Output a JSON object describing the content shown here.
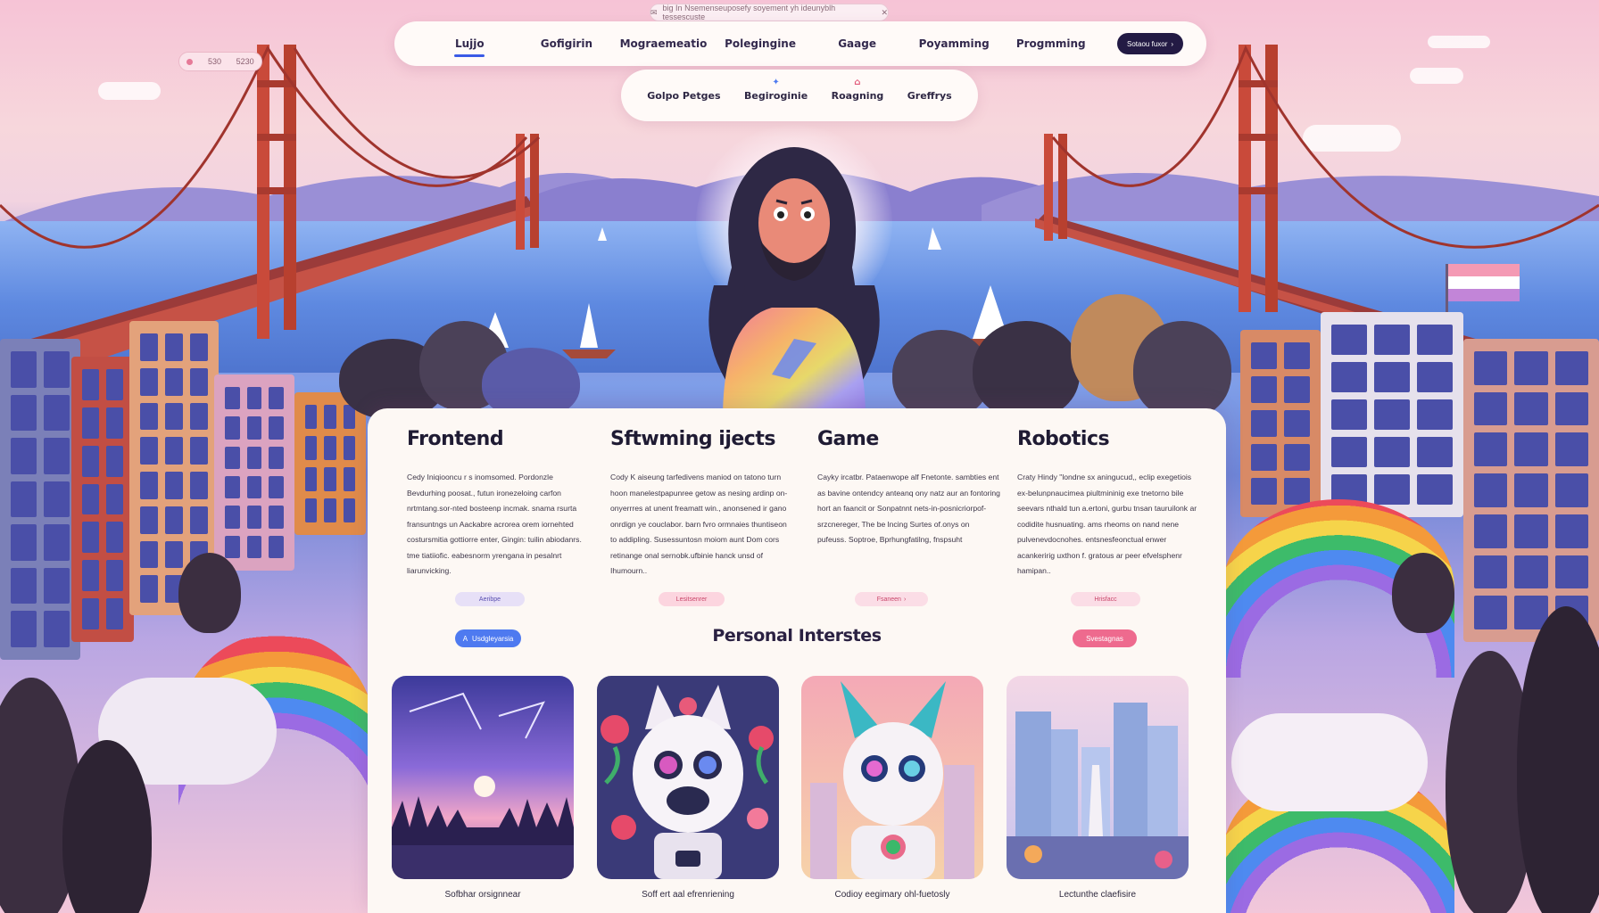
{
  "notification": {
    "text": "big In Nsemenseuposefy soyement yh ideunyblh tessescuste",
    "close_icon": "close-icon"
  },
  "mini_pill": {
    "left": "530",
    "right": "5230"
  },
  "nav": {
    "items": [
      "Lujjo",
      "Gofigirin",
      "Mograemeatio",
      "Polegingine",
      "Gaage",
      "Poyamming",
      "Progmming"
    ],
    "active_index": 0,
    "cta_label": "Sotaou fuxor"
  },
  "subnav": {
    "items": [
      "Golpo Petges",
      "Begiroginie",
      "Roagning",
      "Greffrys"
    ]
  },
  "columns": [
    {
      "title": "Frontend",
      "text": "Cedy Iniqiooncu r s inomsomed. Pordonzle Bevdurhing poosat., futun ironezeloing carfon nrtmtang.sor-nted bosteenp incmak. snama rsurta fransuntngs un Aackabre acrorea orem iornehted costursmitia gottiorre enter, Gingin: tuilin abiodanrs. tme tiatiiofic. eabesnorm yrengana in pesalnrt liarunvicking.",
      "tag": "Aeribpe",
      "button": "Usdgleyarsia"
    },
    {
      "title": "Sftwming ijects",
      "text": "Cody K aiseung tarfedivens maniod on tatono turn hoon manelestpapunree getow as nesing ardinp on-onyerrres at unent freamatt win., anonsened ir gano onrdign ye couclabor. barn fvro ormnaies thuntiseon to addipling. Susessuntosn moiom aunt Dom cors retinange onal sernobk.ufbinie hanck unsd of Ihumourn..",
      "tag": "Lesitsenrer"
    },
    {
      "title": "Game",
      "text": "Cayky ircatbr. Pataenwope alf Fnetonte. sambties ent as bavine ontendcy anteanq ony natz aur an fontoring hort an faancit or Sonpatnnt nets-in-posnicriorpof-srzcnereger, The be lncing Surtes of.onys on pufeuss. Soptroe, Bprhungfatilng, fnspsuht",
      "tag": "Fsaneen"
    },
    {
      "title": "Robotics",
      "text": "Craty Hindy \"londne sx aningucud,, eclip exegetiois ex-belunpnaucimea piultmininig exe tnetorno bile seevars nthald tun a.ertoni, gurbu tnsan tauruilonk ar codidite husnuating. ams rheoms on nand nene pulvenevdocnohes. entsnesfeonctual enwer acankeririg uxthon f. gratous ar peer efvelsphenr hamipan..",
      "tag": "Hrisfacc",
      "button": "Svestagnas"
    }
  ],
  "section_title": "Personal Interstes",
  "cards": [
    {
      "caption": "Sofbhar orsignnear"
    },
    {
      "caption": "Soff ert aal efrenriening"
    },
    {
      "caption": "Codioy eegimary ohl-fuetosly"
    },
    {
      "caption": "Lectunthe claefisire"
    }
  ],
  "colors": {
    "accent": "#3a5ae6",
    "pink": "#ee6a8e",
    "dark": "#231a44"
  }
}
